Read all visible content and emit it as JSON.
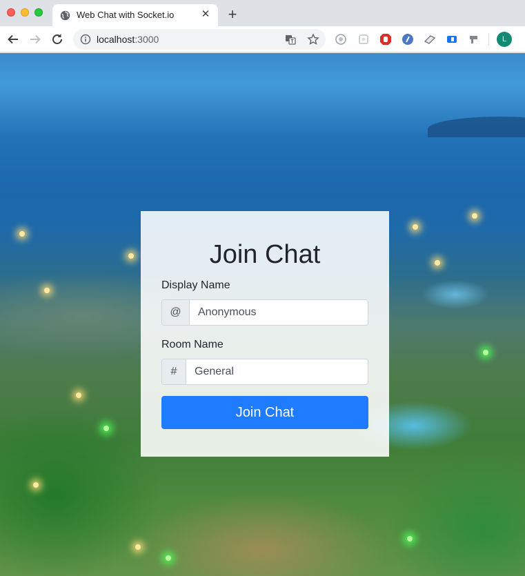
{
  "browser": {
    "tab_title": "Web Chat with Socket.io",
    "tab_close": "✕",
    "new_tab": "+",
    "url_host": "localhost",
    "url_port": ":3000",
    "avatar_letter": "L",
    "icons": [
      "back-icon",
      "forward-icon",
      "reload-icon",
      "info-icon",
      "translate-icon",
      "star-icon"
    ],
    "extensions": [
      "extension-1-icon",
      "extension-2-icon",
      "extension-3-icon",
      "extension-4-icon",
      "extension-5-icon",
      "extension-6-icon",
      "extension-7-icon"
    ]
  },
  "form": {
    "title": "Join Chat",
    "display_name_label": "Display Name",
    "display_name_prefix": "@",
    "display_name_value": "Anonymous",
    "room_name_label": "Room Name",
    "room_name_prefix": "#",
    "room_name_value": "General",
    "submit_label": "Join Chat"
  },
  "colors": {
    "accent": "#1f7bff",
    "avatar": "#138a72"
  }
}
